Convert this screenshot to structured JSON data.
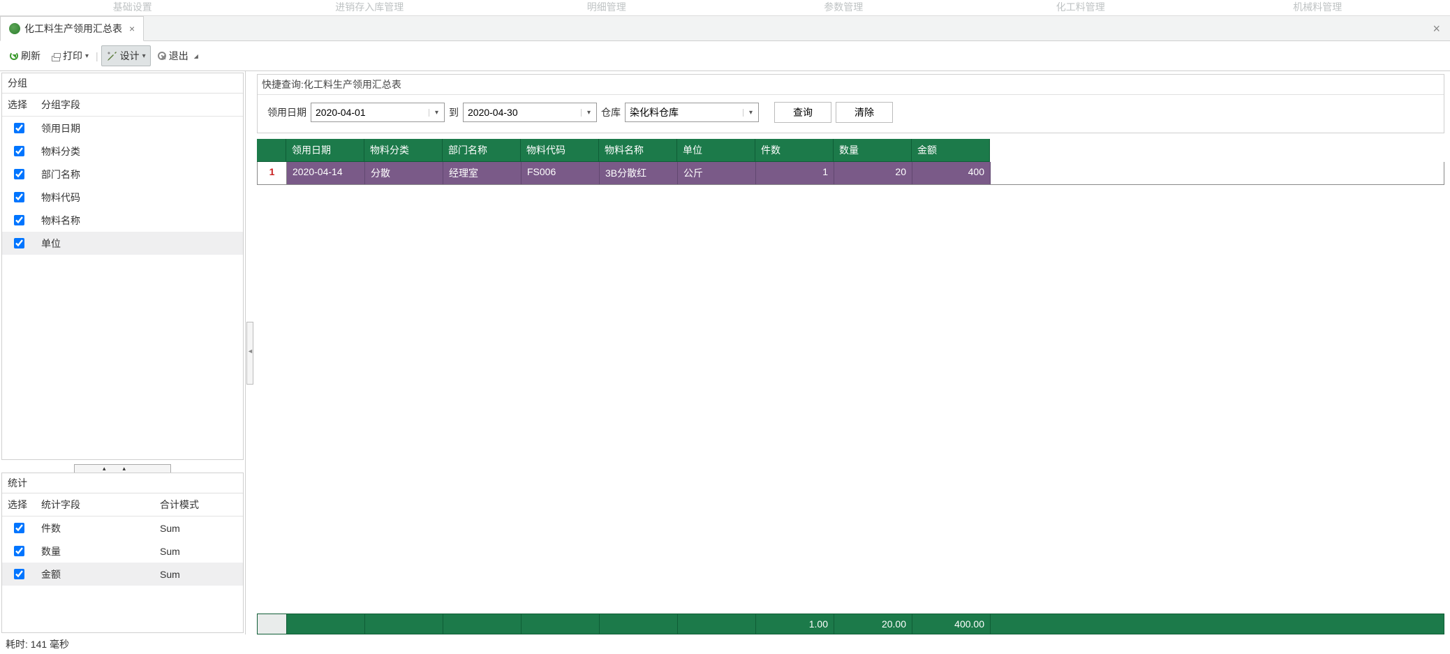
{
  "ghost_tabs": [
    "基础设置",
    "进销存入库管理",
    "明细管理",
    "参数管理",
    "化工料管理",
    "机械料管理"
  ],
  "tab": {
    "title": "化工料生产领用汇总表"
  },
  "toolbar": {
    "refresh": "刷新",
    "print": "打印",
    "design": "设计",
    "exit": "退出"
  },
  "left": {
    "group_title": "分组",
    "group_cols": {
      "select": "选择",
      "field": "分组字段"
    },
    "group_fields": [
      {
        "label": "领用日期",
        "checked": true
      },
      {
        "label": "物料分类",
        "checked": true
      },
      {
        "label": "部门名称",
        "checked": true
      },
      {
        "label": "物料代码",
        "checked": true
      },
      {
        "label": "物料名称",
        "checked": true
      },
      {
        "label": "单位",
        "checked": true
      }
    ],
    "stats_title": "统计",
    "stats_cols": {
      "select": "选择",
      "field": "统计字段",
      "mode": "合计模式"
    },
    "stats_fields": [
      {
        "label": "件数",
        "mode": "Sum",
        "checked": true
      },
      {
        "label": "数量",
        "mode": "Sum",
        "checked": true
      },
      {
        "label": "金额",
        "mode": "Sum",
        "checked": true
      }
    ]
  },
  "query": {
    "title_prefix": "快捷查询:",
    "title_name": "化工料生产领用汇总表",
    "date_label": "领用日期",
    "date_from": "2020-04-01",
    "to": "到",
    "date_to": "2020-04-30",
    "wh_label": "仓库",
    "wh_value": "染化料仓库",
    "search": "查询",
    "clear": "清除"
  },
  "table": {
    "headers": [
      "领用日期",
      "物料分类",
      "部门名称",
      "物料代码",
      "物料名称",
      "单位",
      "件数",
      "数量",
      "金额"
    ],
    "rows": [
      {
        "rn": "1",
        "cells": [
          "2020-04-14",
          "分散",
          "经理室",
          "FS006",
          "3B分散红",
          "公斤",
          "1",
          "20",
          "400"
        ]
      }
    ],
    "footer": [
      "",
      "",
      "",
      "",
      "",
      "",
      "1.00",
      "20.00",
      "400.00"
    ]
  },
  "status": "耗时: 141 毫秒"
}
